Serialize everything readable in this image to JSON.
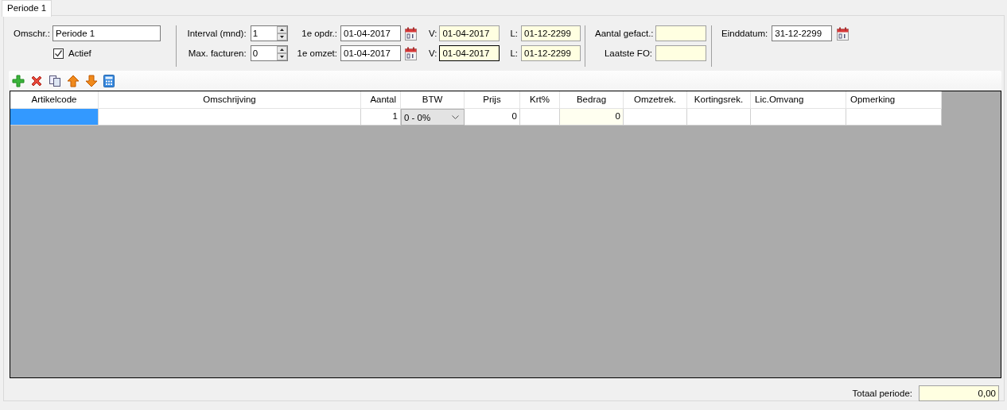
{
  "tabs": [
    {
      "label": "Periode 1",
      "selected": true
    }
  ],
  "form": {
    "description": {
      "label": "Omschr.:",
      "value": "Periode 1"
    },
    "active": {
      "label": "Actief",
      "checked": true
    },
    "spinners": [
      {
        "label": "Interval (mnd):",
        "value": "1"
      },
      {
        "label": "Max. facturen:",
        "value": "0"
      }
    ],
    "date_rows": [
      {
        "label": "1e opdr.:",
        "value": "01-04-2017",
        "from_label": "V:",
        "from_value": "01-04-2017",
        "from_focused": false,
        "to_label": "L:",
        "to_value": "01-12-2299"
      },
      {
        "label": "1e omzet:",
        "value": "01-04-2017",
        "from_label": "V:",
        "from_value": "01-04-2017",
        "from_focused": true,
        "to_label": "L:",
        "to_value": "01-12-2299"
      }
    ],
    "counters": [
      {
        "label": "Aantal gefact.:"
      },
      {
        "label": "Laatste FO:"
      }
    ],
    "end_date": {
      "label": "Einddatum:",
      "value": "31-12-2299"
    }
  },
  "toolbar": [
    {
      "kind": "add"
    },
    {
      "kind": "delete"
    },
    {
      "kind": "copy"
    },
    {
      "kind": "up"
    },
    {
      "kind": "down"
    },
    {
      "kind": "calculator"
    }
  ],
  "table": {
    "columns": [
      {
        "label": "Artikelcode"
      },
      {
        "label": "Omschrijving"
      },
      {
        "label": "Aantal"
      },
      {
        "label": "BTW"
      },
      {
        "label": "Prijs"
      },
      {
        "label": "Krt%"
      },
      {
        "label": "Bedrag"
      },
      {
        "label": "Omzetrek."
      },
      {
        "label": "Kortingsrek."
      },
      {
        "label": "Lic.Omvang"
      },
      {
        "label": "Opmerking"
      }
    ],
    "rows": [
      {
        "cells": [
          {
            "kind": "text",
            "selected": true
          },
          {
            "kind": "text",
            "selected": false
          },
          {
            "kind": "number",
            "value": "1",
            "selected": false
          },
          {
            "kind": "dropdown",
            "value": "0 - 0%",
            "selected": false
          },
          {
            "kind": "number",
            "value": "0",
            "selected": false
          },
          {
            "kind": "text",
            "selected": false
          },
          {
            "kind": "readonly",
            "value": "0",
            "selected": false
          },
          {
            "kind": "text",
            "selected": false
          },
          {
            "kind": "text",
            "selected": false
          },
          {
            "kind": "text",
            "selected": false
          },
          {
            "kind": "text",
            "selected": false
          }
        ]
      }
    ]
  },
  "total": {
    "label": "Totaal periode:",
    "value": "0,00"
  }
}
